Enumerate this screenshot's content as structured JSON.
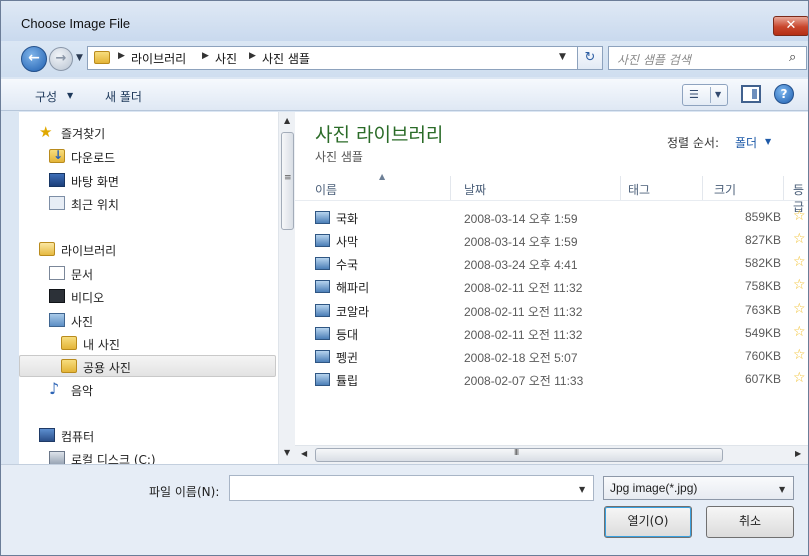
{
  "window": {
    "title": "Choose Image File",
    "close_label": "✕"
  },
  "address": {
    "path": [
      "라이브러리",
      "사진",
      "사진 샘플"
    ],
    "search_placeholder": "사진 샘플 검색"
  },
  "toolbar": {
    "organize": "구성",
    "new_folder": "새 폴더"
  },
  "nav": {
    "favorites": "즐겨찾기",
    "downloads": "다운로드",
    "desktop": "바탕 화면",
    "recent": "최근 위치",
    "libraries": "라이브러리",
    "documents": "문서",
    "videos": "비디오",
    "pictures": "사진",
    "my_pictures": "내 사진",
    "public_pictures": "공용 사진",
    "music": "음악",
    "computer": "컴퓨터",
    "local_disk": "로컬 디스크 (C:)"
  },
  "library": {
    "title": "사진 라이브러리",
    "subtitle": "사진 샘플",
    "sort_label": "정렬 순서:",
    "sort_value": "폴더"
  },
  "columns": {
    "name": "이름",
    "date": "날짜",
    "tags": "태그",
    "size": "크기",
    "rating": "등급"
  },
  "files": [
    {
      "name": "국화",
      "date": "2008-03-14 오후 1:59",
      "size": "859KB"
    },
    {
      "name": "사막",
      "date": "2008-03-14 오후 1:59",
      "size": "827KB"
    },
    {
      "name": "수국",
      "date": "2008-03-24 오후 4:41",
      "size": "582KB"
    },
    {
      "name": "해파리",
      "date": "2008-02-11 오전 11:32",
      "size": "758KB"
    },
    {
      "name": "코알라",
      "date": "2008-02-11 오전 11:32",
      "size": "763KB"
    },
    {
      "name": "등대",
      "date": "2008-02-11 오전 11:32",
      "size": "549KB"
    },
    {
      "name": "펭귄",
      "date": "2008-02-18 오전 5:07",
      "size": "760KB"
    },
    {
      "name": "튤립",
      "date": "2008-02-07 오전 11:33",
      "size": "607KB"
    }
  ],
  "bottom": {
    "filename_label": "파일 이름(N):",
    "filename_value": "",
    "filetype": "Jpg image(*.jpg)",
    "open_label": "열기(O)",
    "cancel_label": "취소"
  },
  "icons": {
    "back": "back-arrow-icon",
    "forward": "forward-arrow-icon",
    "refresh": "refresh-icon",
    "search": "search-icon",
    "view": "view-options-icon",
    "preview": "preview-pane-icon",
    "help": "help-icon",
    "rating": "star-icon"
  },
  "colors": {
    "library_title": "#2a6b27",
    "link": "#1e5aa8",
    "close": "#c8462c"
  }
}
